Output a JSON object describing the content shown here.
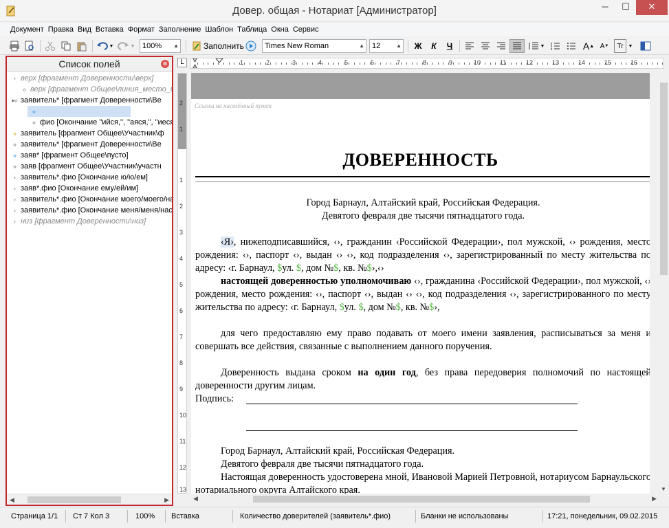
{
  "window": {
    "title": "Довер. общая - Нотариат [Администратор]"
  },
  "menu": [
    "Документ",
    "Правка",
    "Вид",
    "Вставка",
    "Формат",
    "Заполнение",
    "Шаблон",
    "Таблица",
    "Окна",
    "Сервис"
  ],
  "toolbar": {
    "zoom": "100%",
    "fill_label": "Заполнить",
    "font": "Times New Roman",
    "size": "12",
    "bold": "Ж",
    "italic": "К",
    "underline": "Ч"
  },
  "left_panel": {
    "title": "Список полей",
    "items": [
      "верх [фрагмент Доверенности\\верх]",
      "верх [фрагмент Общее\\линия_место_и_д",
      "заявитель* [фрагмент Доверенности\\Ве",
      "",
      "фио [Окончание \"ийся,\", \"аяся,\", \"иеся",
      "заявитель [фрагмент Общее\\Участник\\ф",
      "заявитель* [фрагмент Доверенности\\Ве",
      "заяв* [фрагмент Общее\\пусто]",
      "заяв [фрагмент Общее\\Участник\\участн",
      "заявитель*.фио [Окончание ю/ю/ем]",
      "заяв*.фио [Окончание ему/ей/им]",
      "заявитель*.фио [Окончание моего/моего/на",
      "заявитель*.фио [Окончание меня/меня/нас]",
      "низ [фрагмент Доверенности\\низ]"
    ]
  },
  "ruler": {
    "h_numbers": [
      "1",
      "2",
      "3",
      "4",
      "5",
      "6",
      "7",
      "8",
      "9",
      "10",
      "11",
      "12",
      "13",
      "14",
      "15",
      "16"
    ],
    "v_numbers": [
      "2",
      "1",
      "1",
      "2",
      "3",
      "4",
      "5",
      "6",
      "7",
      "8",
      "9",
      "10",
      "11",
      "12",
      "13"
    ]
  },
  "document": {
    "hint": "Ссылка на населённый пункт",
    "heading": "ДОВЕРЕННОСТЬ",
    "place_line": "Город Барнаул, Алтайский край, Российская Федерация.",
    "date_line": "Девятого февраля две тысячи пятнадцатого года.",
    "p1": {
      "a": "‹Я›",
      "b": ", нижеподписавшийся, ‹›, гражданин ‹Российской Федерации›, пол мужской, ‹› рождения, место рождения: ‹›, паспорт ‹›, выдан ‹› ‹›, код подразделения ‹›, зарегистрированный по месту жительства по адресу: ‹г. Барнаул, ",
      "c": "ул. ",
      "d": ", дом №",
      "e": ", кв. №",
      "f": "›,‹›"
    },
    "p2": {
      "bold": "настоящей доверенностью уполномочиваю",
      "a": "  ‹›, гражданина ‹Российской Федерации›, пол мужской, ‹› рождения, место рождения: ‹›, паспорт ‹›, выдан ‹› ‹›, код подразделения ‹›, зарегистрированного по месту жительства по адресу: ‹г. Барнаул, ",
      "c": "ул. ",
      "d": ", дом №",
      "e": ", кв. №",
      "f": "›,"
    },
    "dollar": "$",
    "p3": "для чего предоставляю ему право подавать от моего имени заявления, расписываться за меня и совершать все действия, связанные с выполнением данного поручения.",
    "p4": {
      "a": "Доверенность выдана сроком ",
      "bold": "на один год",
      "b": ", без права передоверия полномочий по настоящей доверенности другим лицам."
    },
    "sign_label": "Подпись:",
    "footer_place": "Город Барнаул, Алтайский край, Российская Федерация.",
    "footer_date": "Девятого февраля две тысячи пятнадцатого года.",
    "footer_notary": "Настоящая доверенность удостоверена мной, Ивановой Марией Петровной, нотариусом Барнаульского нотариального округа Алтайского края."
  },
  "status": {
    "page": "Страница 1/1",
    "pos": "Ст 7  Кол 3",
    "zoom": "100%",
    "mode": "Вставка",
    "field": "Количество доверителей (заявитель*.фио)",
    "blanks": "Бланки не использованы",
    "datetime": "17:21, понедельник, 09.02.2015"
  }
}
